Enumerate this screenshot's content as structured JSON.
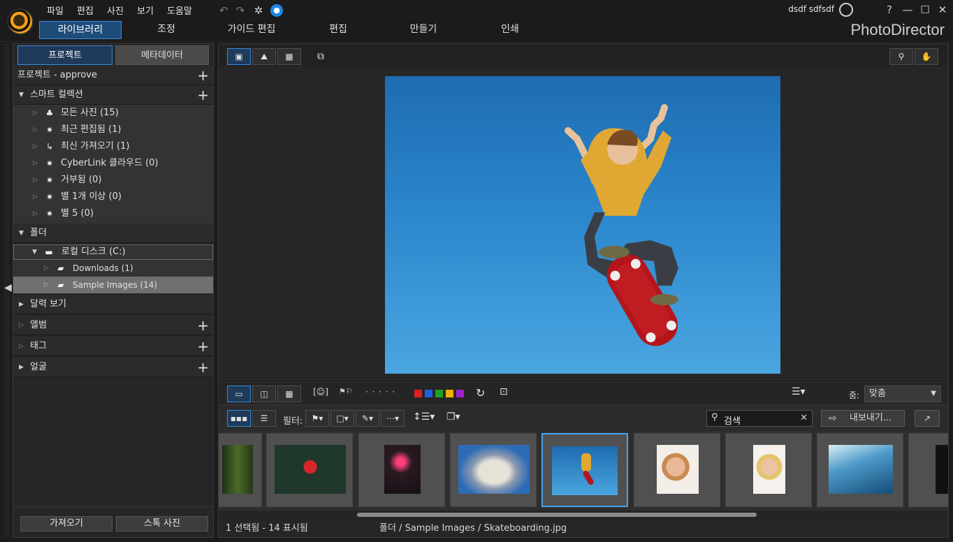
{
  "menu": [
    "파일",
    "편집",
    "사진",
    "보기",
    "도움말"
  ],
  "user": {
    "name": "dsdf sdfsdf"
  },
  "window_controls": {
    "help": "?",
    "minimize": "—",
    "maximize": "☐",
    "close": "✕"
  },
  "modes": [
    "라이브러리",
    "조정",
    "가이드 편집",
    "편집",
    "만들기",
    "인쇄"
  ],
  "brand": "PhotoDirector",
  "panel_tabs": {
    "project": "프로젝트",
    "metadata": "메타데이터"
  },
  "project_header": "프로젝트 - approve",
  "smart_collection": {
    "label": "스마트 컬렉션",
    "items": [
      {
        "label": "모든 사진 (15)",
        "icon": "hierarchy-icon"
      },
      {
        "label": "최근 편집됨 (1)",
        "icon": "magic-wand-icon"
      },
      {
        "label": "최신 가져오기 (1)",
        "icon": "import-arrow-icon"
      },
      {
        "label": "CyberLink 클라우드 (0)",
        "icon": "magic-wand-icon"
      },
      {
        "label": "거부됨 (0)",
        "icon": "magic-wand-icon"
      },
      {
        "label": "별 1개 이상 (0)",
        "icon": "magic-wand-icon"
      },
      {
        "label": "별 5 (0)",
        "icon": "magic-wand-icon"
      }
    ]
  },
  "folders": {
    "label": "폴더",
    "drive": "로컬 디스크 (C:)",
    "items": [
      "Downloads (1)",
      "Sample Images (14)"
    ]
  },
  "calendar": "달력 보기",
  "album": "앨범",
  "tags": "태그",
  "faces": "얼굴",
  "panel_buttons": {
    "import": "가져오기",
    "stock": "스톡 사진"
  },
  "strip_toolbar": {
    "dots": "· · · · ·",
    "zoom_label": "줌:",
    "zoom_value": "맞춤",
    "color_labels": [
      "#e02020",
      "#2060e0",
      "#20a020",
      "#f0b000",
      "#a020d0"
    ]
  },
  "filter_toolbar": {
    "filter_label": "필터:",
    "search_placeholder": "검색",
    "export_label": "내보내기..."
  },
  "status": {
    "selection": "1 선택됨 - 14 표시됨",
    "path": "폴더 / Sample Images / Skateboarding.jpg"
  },
  "thumbnails": [
    {
      "name": "forest",
      "selected": false
    },
    {
      "name": "red-leaf",
      "selected": false
    },
    {
      "name": "neon-storefront",
      "selected": false
    },
    {
      "name": "rocket-launch",
      "selected": false
    },
    {
      "name": "skateboarding",
      "selected": true
    },
    {
      "name": "smiling-woman",
      "selected": false
    },
    {
      "name": "surprised-woman",
      "selected": false
    },
    {
      "name": "ocean-wave",
      "selected": false
    }
  ]
}
